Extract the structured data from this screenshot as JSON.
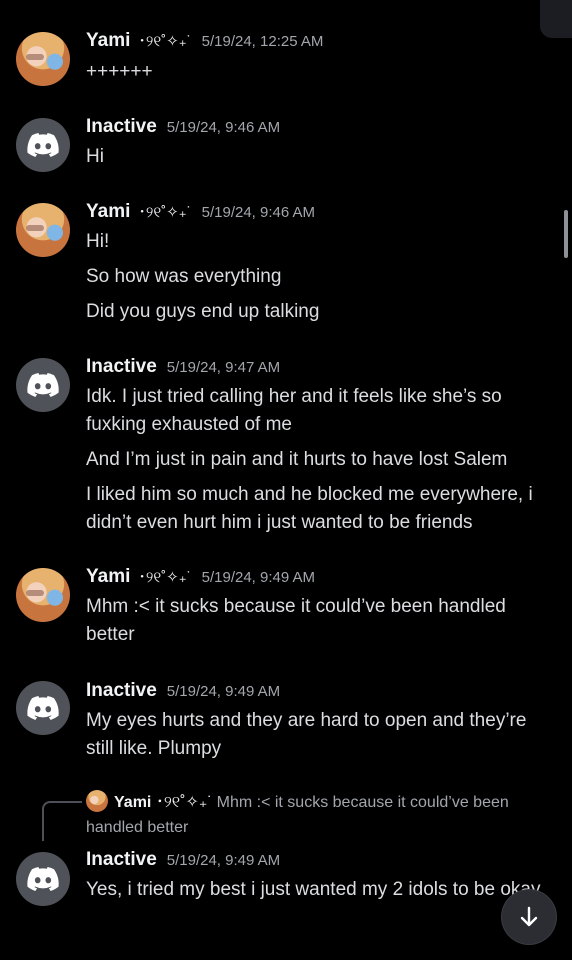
{
  "users": {
    "yami": {
      "name": "Yami",
      "decoration": "･୨୧˚✧₊˙"
    },
    "inactive": {
      "name": "Inactive"
    }
  },
  "messages": [
    {
      "author": "Yami",
      "decoration": "･୨୧˚✧₊˙",
      "timestamp": "5/19/24, 12:25 AM",
      "lines": [
        "++++++"
      ]
    },
    {
      "author": "Inactive",
      "timestamp": "5/19/24, 9:46 AM",
      "lines": [
        "Hi"
      ]
    },
    {
      "author": "Yami",
      "decoration": "･୨୧˚✧₊˙",
      "timestamp": "5/19/24, 9:46 AM",
      "lines": [
        "Hi!",
        "So how was everything",
        "Did you guys end up talking"
      ]
    },
    {
      "author": "Inactive",
      "timestamp": "5/19/24, 9:47 AM",
      "lines": [
        "Idk. I just tried calling her and it feels like she’s so fuxking exhausted of me",
        "And I’m just in pain and it hurts to have lost Salem",
        "I liked him so much and he blocked me everywhere, i didn’t even hurt him i just wanted to be friends"
      ]
    },
    {
      "author": "Yami",
      "decoration": "･୨୧˚✧₊˙",
      "timestamp": "5/19/24, 9:49 AM",
      "lines": [
        "Mhm :< it sucks because it could’ve been handled better"
      ]
    },
    {
      "author": "Inactive",
      "timestamp": "5/19/24, 9:49 AM",
      "lines": [
        "My eyes hurts and they are hard to open and they’re still like. Plumpy"
      ]
    },
    {
      "author": "Inactive",
      "timestamp": "5/19/24, 9:49 AM",
      "lines": [
        "Yes, i tried my best i just wanted my 2 idols to be okay"
      ],
      "reply_to": {
        "author": "Yami",
        "decoration": "･୨୧˚✧₊˙",
        "text": "Mhm :< it sucks because it could’ve been handled better"
      }
    }
  ],
  "icons": {
    "jump": "arrow-down-icon",
    "bot_avatar": "discord-logo-icon"
  },
  "colors": {
    "background": "#000000",
    "username": "#f2f3f5",
    "text": "#dcdde1",
    "timestamp": "#a3a6ad",
    "default_avatar": "#4f5359"
  }
}
